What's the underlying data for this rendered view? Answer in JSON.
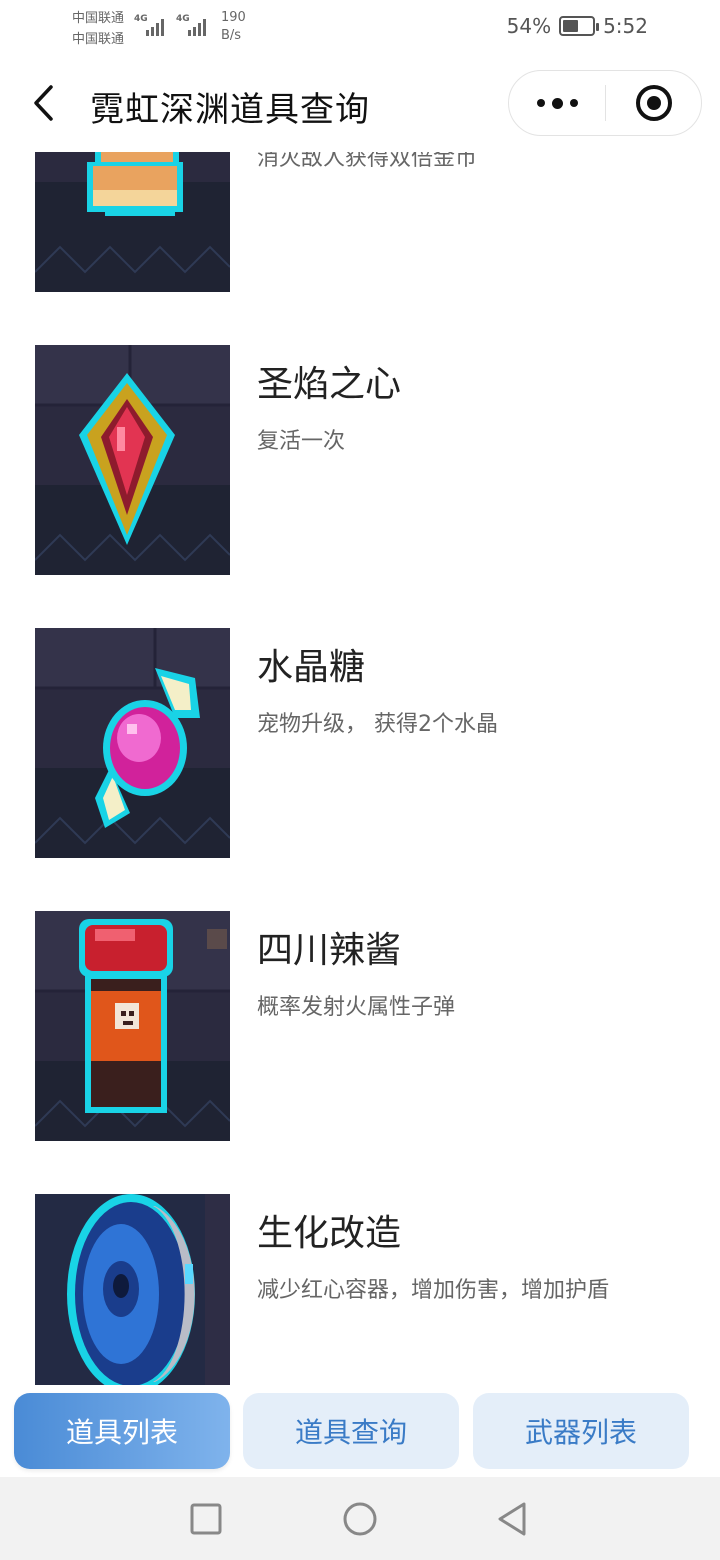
{
  "status_bar": {
    "carriers": [
      "中国联通",
      "中国联通"
    ],
    "signal_tags": [
      "4G",
      "4G"
    ],
    "net_speed_value": "190",
    "net_speed_unit": "B/s",
    "battery_percent": "54%",
    "battery_level": 0.54,
    "time": "5:52"
  },
  "title_bar": {
    "title": "霓虹深渊道具查询",
    "back_icon": "chevron-left-icon",
    "menu_icon": "more-dots-icon",
    "close_icon": "target-circle-icon"
  },
  "items": [
    {
      "name": "",
      "desc": "消灭敌人获得双倍金币",
      "icon": "golden-glove-icon"
    },
    {
      "name": "圣焰之心",
      "desc": "复活一次",
      "icon": "red-gem-icon"
    },
    {
      "name": "水晶糖",
      "desc": "宠物升级， 获得2个水晶",
      "icon": "pink-candy-icon"
    },
    {
      "name": "四川辣酱",
      "desc": "概率发射火属性子弹",
      "icon": "chili-sauce-bottle-icon"
    },
    {
      "name": "生化改造",
      "desc": "减少红心容器，增加伤害，增加护盾",
      "icon": "bionic-eye-icon"
    }
  ],
  "tabs": [
    {
      "label": "道具列表",
      "active": true
    },
    {
      "label": "道具查询",
      "active": false
    },
    {
      "label": "武器列表",
      "active": false
    }
  ],
  "colors": {
    "tab_active_start": "#4a8bd6",
    "tab_active_end": "#7fb3ec",
    "tab_inactive_bg": "#e4eef9",
    "tab_inactive_text": "#3a7bc6",
    "thumb_bg": "#2b2a3f",
    "neon_outline": "#19d3e6"
  },
  "system_nav": [
    "square-recents-icon",
    "circle-home-icon",
    "triangle-back-icon"
  ]
}
